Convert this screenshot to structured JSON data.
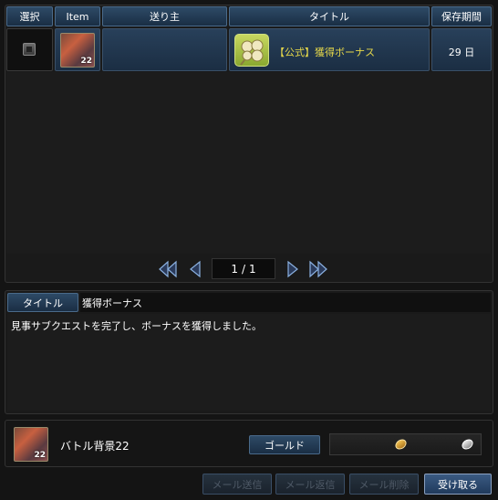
{
  "table": {
    "headers": {
      "select": "選択",
      "item": "Item",
      "sender": "送り主",
      "title": "タイトル",
      "retention": "保存期間"
    },
    "rows": [
      {
        "sender": "",
        "title": "【公式】獲得ボーナス",
        "retention": "29 日",
        "item_level": "22"
      }
    ]
  },
  "pager": {
    "current": "1",
    "separator": "/",
    "total": "1"
  },
  "detail": {
    "title_label": "タイトル",
    "title_value": "獲得ボーナス",
    "body": "見事サブクエストを完了し、ボーナスを獲得しました。"
  },
  "attachment": {
    "name": "バトル背景22",
    "item_level": "22",
    "gold_label": "ゴールド"
  },
  "buttons": {
    "send": "メール送信",
    "reply": "メール返信",
    "delete": "メール削除",
    "receive": "受け取る"
  },
  "colors": {
    "title_link": "#e6d84a",
    "header_bg": "#2e4a66",
    "accent_border": "#8aa0c0"
  }
}
